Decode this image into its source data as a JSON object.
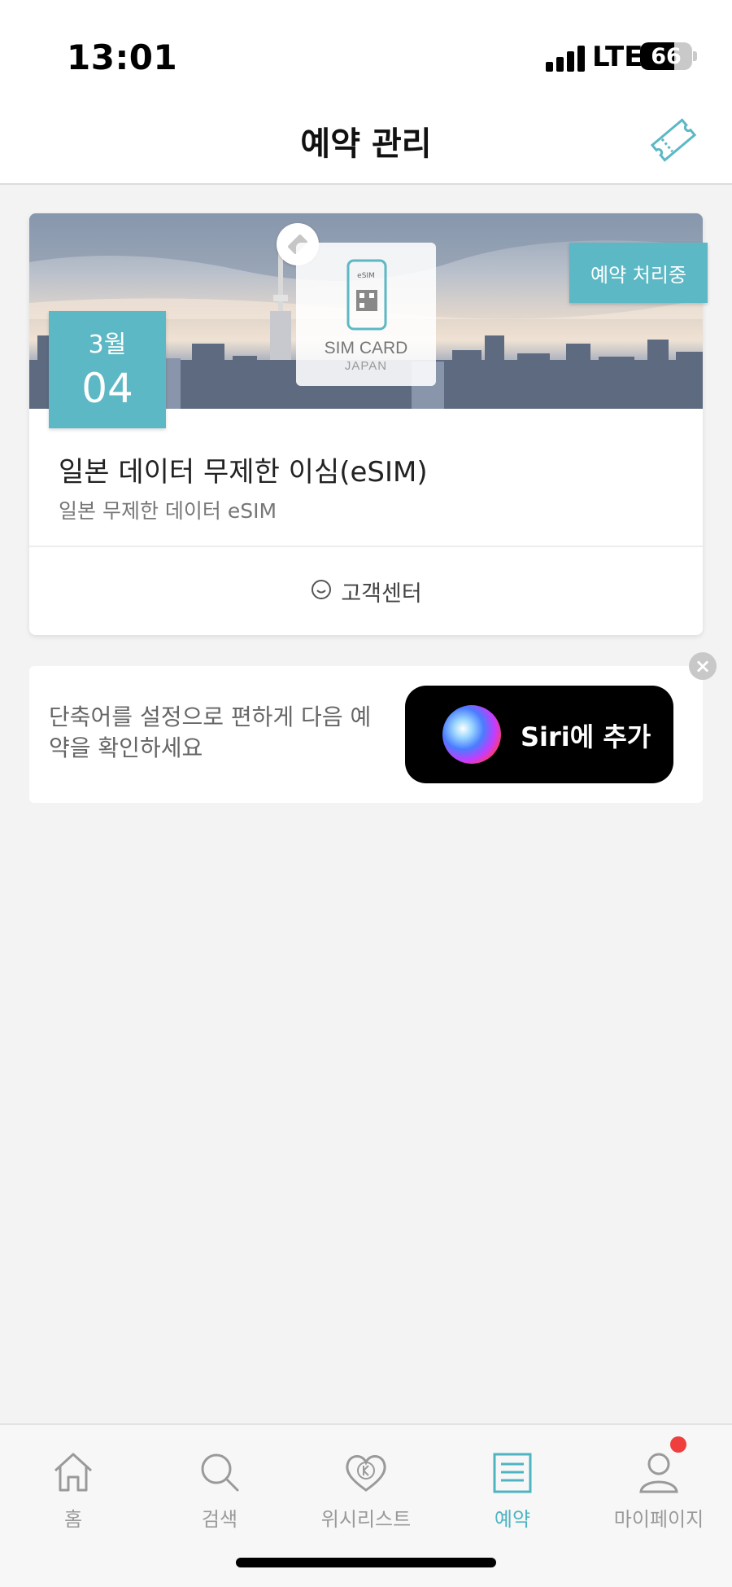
{
  "status_bar": {
    "time": "13:01",
    "network": "LTE",
    "battery": "66",
    "battery_level": 0.66
  },
  "header": {
    "title": "예약 관리",
    "ticket_icon": "ticket-icon"
  },
  "reservation": {
    "status": "예약 처리중",
    "date_month": "3월",
    "date_day": "04",
    "banner_card_title": "SIM CARD",
    "banner_card_subtitle": "JAPAN",
    "banner_card_phone_text": "eSIM",
    "title": "일본 데이터 무제한 이심(eSIM)",
    "subtitle": "일본 무제한 데이터 eSIM",
    "customer_center": "고객센터"
  },
  "siri_card": {
    "message": "단축어를 설정으로 편하게 다음 예약을 확인하세요",
    "button_label": "Siri에 추가"
  },
  "tab_bar": {
    "items": [
      {
        "label": "홈",
        "icon": "home-icon"
      },
      {
        "label": "검색",
        "icon": "search-icon"
      },
      {
        "label": "위시리스트",
        "icon": "heart-icon"
      },
      {
        "label": "예약",
        "icon": "list-icon",
        "active": true
      },
      {
        "label": "마이페이지",
        "icon": "person-icon"
      }
    ]
  },
  "colors": {
    "accent": "#5cb8c4",
    "notification": "#f03e3e",
    "background": "#f3f3f4"
  }
}
